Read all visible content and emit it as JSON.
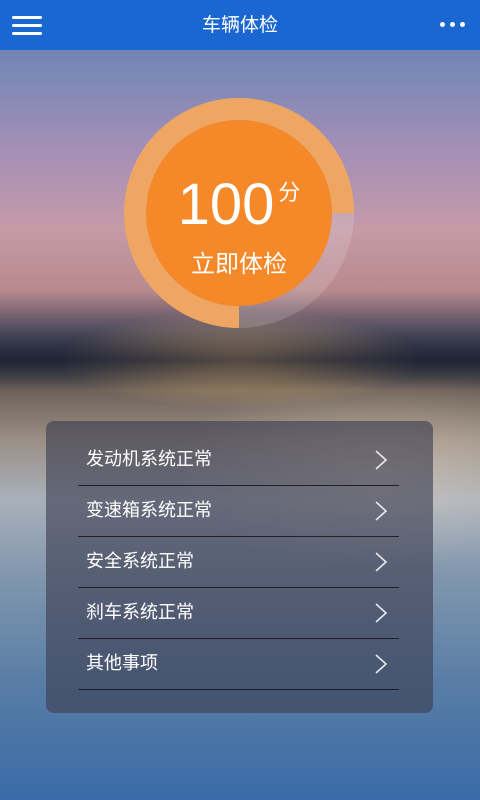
{
  "header": {
    "title": "车辆体检"
  },
  "score": {
    "value": "100",
    "unit": "分",
    "action": "立即体检",
    "progress_fraction": 0.75,
    "colors": {
      "fill": "#f5892a",
      "ring": "#f0a663",
      "ring_track": "rgba(255,255,255,0.15)"
    }
  },
  "checks": {
    "items": [
      {
        "label": "发动机系统正常"
      },
      {
        "label": "变速箱系统正常"
      },
      {
        "label": "安全系统正常"
      },
      {
        "label": "刹车系统正常"
      },
      {
        "label": "其他事项"
      }
    ]
  },
  "colors": {
    "accent": "#1a67d2",
    "orange": "#f5892a"
  },
  "icons": [
    "menu-icon",
    "more-icon",
    "chevron-right-icon"
  ]
}
